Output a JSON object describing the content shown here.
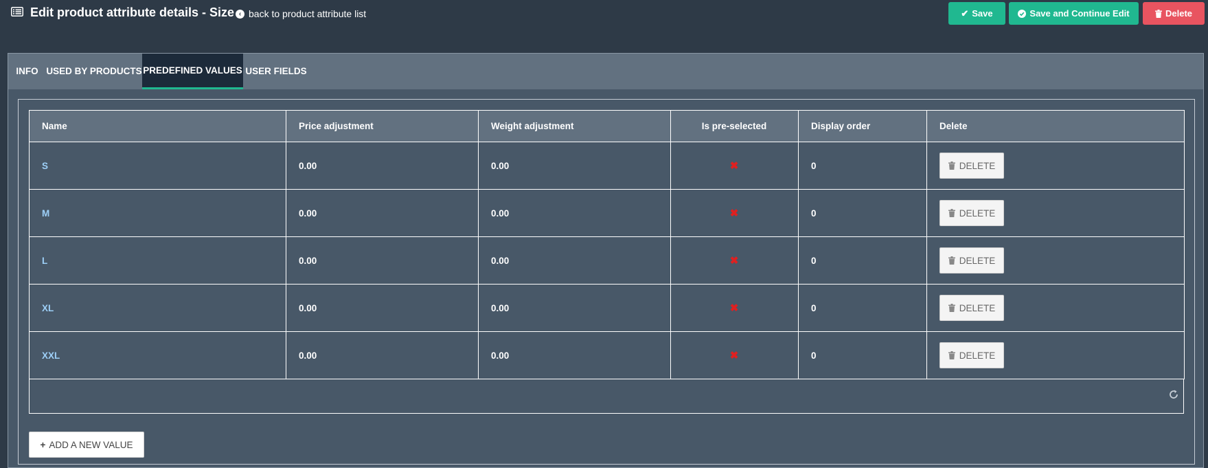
{
  "header": {
    "title": "Edit product attribute details - Size",
    "back_link": "back to product attribute list"
  },
  "actions": {
    "save": "Save",
    "save_continue": "Save and Continue Edit",
    "delete": "Delete"
  },
  "tabs": [
    {
      "label": "INFO",
      "active": false
    },
    {
      "label": "USED BY PRODUCTS",
      "active": false
    },
    {
      "label": "PREDEFINED VALUES",
      "active": true
    },
    {
      "label": "USER FIELDS",
      "active": false
    }
  ],
  "table": {
    "columns": [
      "Name",
      "Price adjustment",
      "Weight adjustment",
      "Is pre-selected",
      "Display order",
      "Delete"
    ],
    "rows": [
      {
        "name": "S",
        "price": "0.00",
        "weight": "0.00",
        "preselected": false,
        "order": "0",
        "delete": "DELETE"
      },
      {
        "name": "M",
        "price": "0.00",
        "weight": "0.00",
        "preselected": false,
        "order": "0",
        "delete": "DELETE"
      },
      {
        "name": "L",
        "price": "0.00",
        "weight": "0.00",
        "preselected": false,
        "order": "0",
        "delete": "DELETE"
      },
      {
        "name": "XL",
        "price": "0.00",
        "weight": "0.00",
        "preselected": false,
        "order": "0",
        "delete": "DELETE"
      },
      {
        "name": "XXL",
        "price": "0.00",
        "weight": "0.00",
        "preselected": false,
        "order": "0",
        "delete": "DELETE"
      }
    ]
  },
  "add_button": "ADD A NEW VALUE",
  "colors": {
    "accent": "#20b890",
    "danger": "#e85460",
    "link": "#9dcff7",
    "background": "#2e3a47",
    "panel": "#485868"
  },
  "icons": {
    "title": "list-icon",
    "back": "arrow-circle-left-icon",
    "save": "check-icon",
    "save_continue": "check-circle-icon",
    "delete": "trash-icon",
    "preselected_false": "x-mark-icon",
    "refresh": "refresh-icon",
    "add": "plus-icon"
  }
}
